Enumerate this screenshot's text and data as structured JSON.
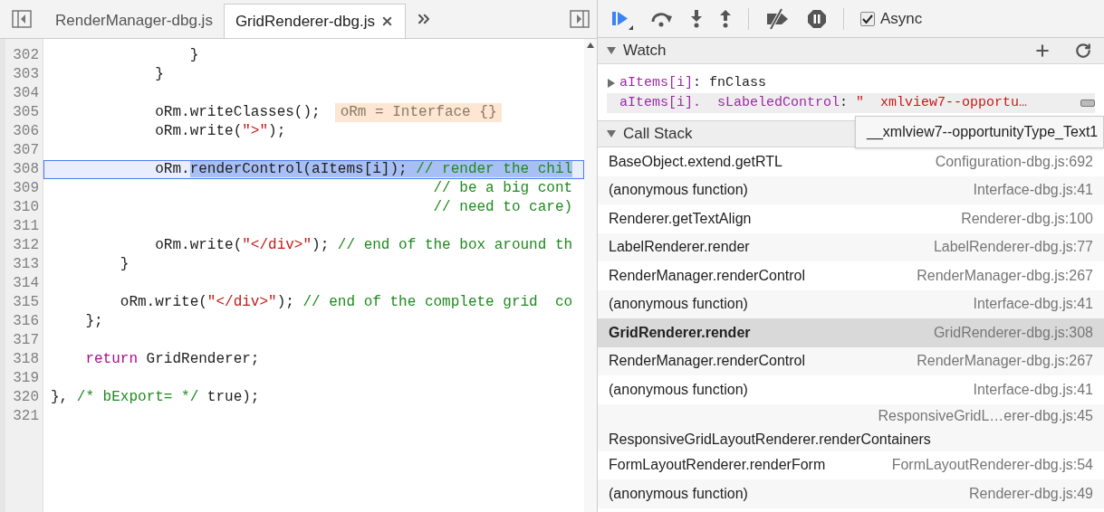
{
  "editor": {
    "tabs": [
      {
        "label": "RenderManager-dbg.js",
        "selected": false
      },
      {
        "label": "GridRenderer-dbg.js",
        "selected": true
      }
    ],
    "lines": [
      {
        "number": "302",
        "current": false,
        "tokens": [
          {
            "kind": "plain",
            "text": "                }",
            "selected": false
          }
        ]
      },
      {
        "number": "303",
        "current": false,
        "tokens": [
          {
            "kind": "plain",
            "text": "            }",
            "selected": false
          }
        ]
      },
      {
        "number": "304",
        "current": false
      },
      {
        "number": "305",
        "current": false,
        "tokens": [
          {
            "kind": "plain",
            "text": "            oRm.writeClasses();",
            "selected": false
          }
        ],
        "inline_value": "oRm = Interface {}"
      },
      {
        "number": "306",
        "current": false,
        "tokens": [
          {
            "kind": "plain",
            "text": "            oRm.write(",
            "selected": false
          },
          {
            "kind": "string",
            "text": "\">\"",
            "selected": false
          },
          {
            "kind": "plain",
            "text": ");",
            "selected": false
          }
        ]
      },
      {
        "number": "307",
        "current": false
      },
      {
        "number": "308",
        "current": true,
        "tokens": [
          {
            "kind": "plain",
            "text": "            oRm.",
            "selected": false
          },
          {
            "kind": "plain",
            "text": "renderControl(aItems[i]); ",
            "selected": true
          },
          {
            "kind": "comment",
            "text": "// render the chil",
            "selected": true
          }
        ]
      },
      {
        "number": "309",
        "current": false,
        "tokens": [
          {
            "kind": "comment",
            "text": "                                            // be a big cont",
            "selected": false
          }
        ]
      },
      {
        "number": "310",
        "current": false,
        "tokens": [
          {
            "kind": "comment",
            "text": "                                            // need to care)",
            "selected": false
          }
        ]
      },
      {
        "number": "311",
        "current": false
      },
      {
        "number": "312",
        "current": false,
        "tokens": [
          {
            "kind": "plain",
            "text": "            oRm.write(",
            "selected": false
          },
          {
            "kind": "string",
            "text": "\"</div>\"",
            "selected": false
          },
          {
            "kind": "plain",
            "text": "); ",
            "selected": false
          },
          {
            "kind": "comment",
            "text": "// end of the box around th",
            "selected": false
          }
        ]
      },
      {
        "number": "313",
        "current": false,
        "tokens": [
          {
            "kind": "plain",
            "text": "        }",
            "selected": false
          }
        ]
      },
      {
        "number": "314",
        "current": false
      },
      {
        "number": "315",
        "current": false,
        "tokens": [
          {
            "kind": "plain",
            "text": "        oRm.write(",
            "selected": false
          },
          {
            "kind": "string",
            "text": "\"</div>\"",
            "selected": false
          },
          {
            "kind": "plain",
            "text": "); ",
            "selected": false
          },
          {
            "kind": "comment",
            "text": "// end of the complete grid  co",
            "selected": false
          }
        ]
      },
      {
        "number": "316",
        "current": false,
        "tokens": [
          {
            "kind": "plain",
            "text": "    };",
            "selected": false
          }
        ]
      },
      {
        "number": "317",
        "current": false
      },
      {
        "number": "318",
        "current": false,
        "tokens": [
          {
            "kind": "keyword",
            "text": "    return",
            "selected": false
          },
          {
            "kind": "plain",
            "text": " GridRenderer;",
            "selected": false
          }
        ]
      },
      {
        "number": "319",
        "current": false
      },
      {
        "number": "320",
        "current": false,
        "tokens": [
          {
            "kind": "plain",
            "text": "}, ",
            "selected": false
          },
          {
            "kind": "comment",
            "text": "/* bExport= */",
            "selected": false
          },
          {
            "kind": "plain",
            "text": " true);",
            "selected": false
          }
        ]
      },
      {
        "number": "321",
        "current": false
      }
    ]
  },
  "debugger": {
    "async": {
      "label": "Async",
      "checked": true
    },
    "watch": {
      "title": "Watch",
      "expanded": true,
      "expressions": [
        {
          "name": "aItems[i]",
          "separator": ":",
          "value": "fnClass",
          "kind": "object",
          "expandable": true,
          "hovered": false
        },
        {
          "name": "aItems[i].  sLabeledControl",
          "separator": ":",
          "value": "\"  xmlview7--opportu…",
          "kind": "string",
          "expandable": false,
          "hovered": true
        }
      ]
    },
    "tooltip": "__xmlview7--opportunityType_Text1",
    "call_stack": {
      "title": "Call Stack",
      "expanded": true,
      "frames": [
        {
          "kind": "inline",
          "function": "BaseObject.extend.getRTL",
          "location": "Configuration-dbg.js:692",
          "selected": false
        },
        {
          "kind": "inline",
          "function": "(anonymous function)",
          "location": "Interface-dbg.js:41",
          "selected": false
        },
        {
          "kind": "inline",
          "function": "Renderer.getTextAlign",
          "location": "Renderer-dbg.js:100",
          "selected": false
        },
        {
          "kind": "inline",
          "function": "LabelRenderer.render",
          "location": "LabelRenderer-dbg.js:77",
          "selected": false
        },
        {
          "kind": "inline",
          "function": "RenderManager.renderControl",
          "location": "RenderManager-dbg.js:267",
          "selected": false
        },
        {
          "kind": "inline",
          "function": "(anonymous function)",
          "location": "Interface-dbg.js:41",
          "selected": false
        },
        {
          "kind": "inline",
          "function": "GridRenderer.render",
          "location": "GridRenderer-dbg.js:308",
          "selected": true
        },
        {
          "kind": "inline",
          "function": "RenderManager.renderControl",
          "location": "RenderManager-dbg.js:267",
          "selected": false
        },
        {
          "kind": "inline",
          "function": "(anonymous function)",
          "location": "Interface-dbg.js:41",
          "selected": false
        },
        {
          "kind": "wrapped",
          "function": "ResponsiveGridLayoutRenderer.renderContainers",
          "location": "ResponsiveGridL…erer-dbg.js:45",
          "selected": false
        },
        {
          "kind": "inline",
          "function": "FormLayoutRenderer.renderForm",
          "location": "FormLayoutRenderer-dbg.js:54",
          "selected": false
        },
        {
          "kind": "inline",
          "function": "(anonymous function)",
          "location": "Renderer-dbg.js:49",
          "selected": false
        }
      ]
    }
  }
}
